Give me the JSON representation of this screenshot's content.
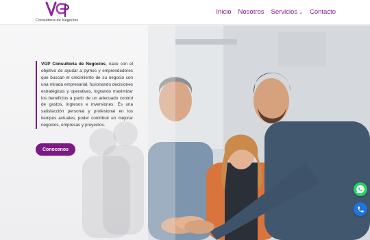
{
  "header": {
    "logo": {
      "mark": "VGP",
      "text": "Consultoria de Negocios"
    },
    "nav": [
      {
        "label": "Inicio"
      },
      {
        "label": "Nosotros"
      },
      {
        "label": "Servicios",
        "has_dropdown": true
      },
      {
        "label": "Contacto"
      }
    ]
  },
  "hero": {
    "intro_bold": "VGP Consultoria de Negocios",
    "intro_text": ", nace con el objetivo de ayudar a pymes y emprendedores que buscan el crecimiento de su negocio con una mirada empresarial, fusionando decisiones estratégicas y operativas, logrando maximizar los beneficios a partir de un adecuado control de gastos, ingresos e inversiones. Es una satisfacción personal y profesional en los tiempos actuales, poder contribuir en mejorar negocios, empresas y proyectos.",
    "cta_label": "Conocenos"
  },
  "floating": {
    "whatsapp_icon": "whatsapp-icon",
    "phone_icon": "phone-icon"
  },
  "colors": {
    "brand": "#7b1a86",
    "whatsapp": "#25d366",
    "phone": "#1f74e0"
  }
}
